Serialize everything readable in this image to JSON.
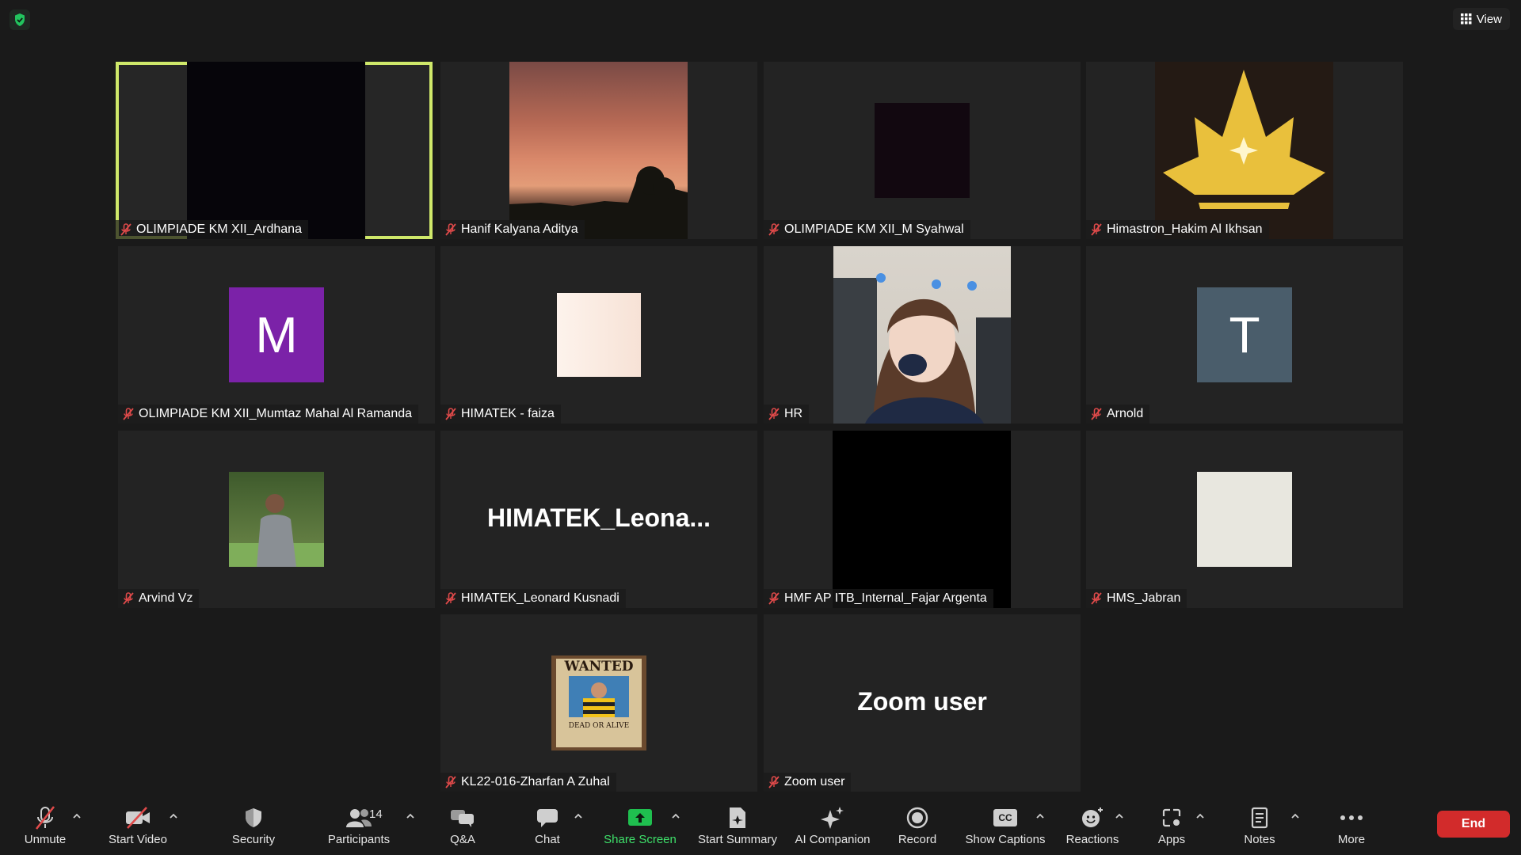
{
  "topbar": {
    "view_label": "View"
  },
  "tiles": [
    {
      "name": "OLIMPIADE KM XII_Ardhana"
    },
    {
      "name": "Hanif Kalyana Aditya"
    },
    {
      "name": "OLIMPIADE KM XII_M Syahwal"
    },
    {
      "name": "Himastron_Hakim Al Ikhsan"
    },
    {
      "name": "OLIMPIADE KM XII_Mumtaz Mahal Al Ramanda",
      "avatar_letter": "M",
      "avatar_color": "#7b22a8"
    },
    {
      "name": "HIMATEK - faiza"
    },
    {
      "name": "HR"
    },
    {
      "name": "Arnold",
      "avatar_letter": "T",
      "avatar_color": "#4a5d6b"
    },
    {
      "name": "Arvind Vz"
    },
    {
      "name": "HIMATEK_Leonard Kusnadi",
      "display_text": "HIMATEK_Leona..."
    },
    {
      "name": "HMF AP ITB_Internal_Fajar Argenta"
    },
    {
      "name": "HMS_Jabran"
    },
    {
      "name": "KL22-016-Zharfan A Zuhal",
      "poster_text": "WANTED",
      "poster_sub": "DEAD OR ALIVE"
    },
    {
      "name": "Zoom user",
      "display_text": "Zoom user"
    }
  ],
  "toolbar": {
    "unmute": "Unmute",
    "start_video": "Start Video",
    "security": "Security",
    "participants": "Participants",
    "participants_count": "14",
    "qa": "Q&A",
    "chat": "Chat",
    "share_screen": "Share Screen",
    "start_summary": "Start Summary",
    "ai_companion": "AI Companion",
    "record": "Record",
    "show_captions": "Show Captions",
    "cc_icon_text": "CC",
    "reactions": "Reactions",
    "apps": "Apps",
    "notes": "Notes",
    "more": "More",
    "end": "End"
  },
  "colors": {
    "active_speaker": "#cfe86a",
    "share_green": "#1fbf4f",
    "end_red": "#d22b2b"
  }
}
